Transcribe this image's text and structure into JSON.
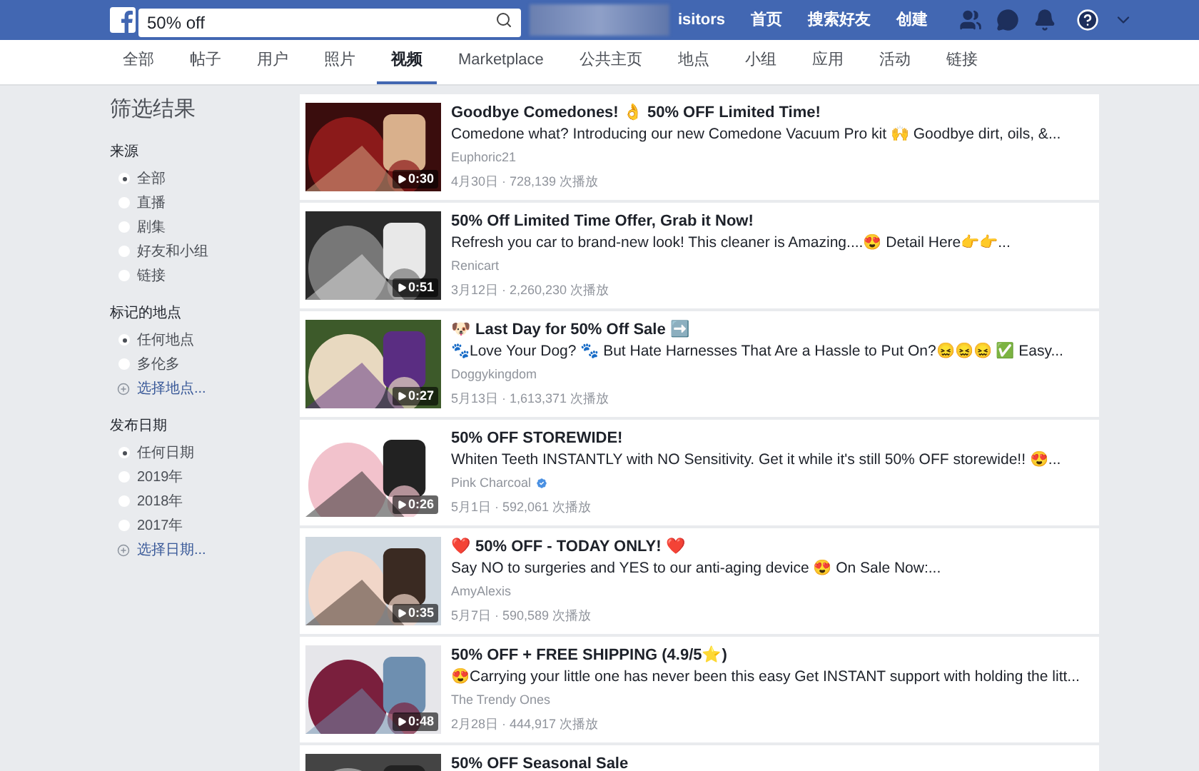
{
  "top_bar": {
    "search": {
      "value": "50% off"
    },
    "nav_partial": "isitors",
    "nav": [
      "首页",
      "搜索好友",
      "创建"
    ]
  },
  "tabs": [
    {
      "label": "全部",
      "selected": false
    },
    {
      "label": "帖子",
      "selected": false
    },
    {
      "label": "用户",
      "selected": false
    },
    {
      "label": "照片",
      "selected": false
    },
    {
      "label": "视频",
      "selected": true
    },
    {
      "label": "Marketplace",
      "selected": false
    },
    {
      "label": "公共主页",
      "selected": false
    },
    {
      "label": "地点",
      "selected": false
    },
    {
      "label": "小组",
      "selected": false
    },
    {
      "label": "应用",
      "selected": false
    },
    {
      "label": "活动",
      "selected": false
    },
    {
      "label": "链接",
      "selected": false
    }
  ],
  "sidebar": {
    "title": "筛选结果",
    "sections": [
      {
        "heading": "来源",
        "items": [
          {
            "kind": "radio",
            "label": "全部",
            "selected": true
          },
          {
            "kind": "radio",
            "label": "直播",
            "selected": false
          },
          {
            "kind": "radio",
            "label": "剧集",
            "selected": false
          },
          {
            "kind": "radio",
            "label": "好友和小组",
            "selected": false
          },
          {
            "kind": "radio",
            "label": "链接",
            "selected": false
          }
        ]
      },
      {
        "heading": "标记的地点",
        "items": [
          {
            "kind": "radio",
            "label": "任何地点",
            "selected": true
          },
          {
            "kind": "radio",
            "label": "多伦多",
            "selected": false
          },
          {
            "kind": "link",
            "label": "选择地点..."
          }
        ]
      },
      {
        "heading": "发布日期",
        "items": [
          {
            "kind": "radio",
            "label": "任何日期",
            "selected": true
          },
          {
            "kind": "radio",
            "label": "2019年",
            "selected": false
          },
          {
            "kind": "radio",
            "label": "2018年",
            "selected": false
          },
          {
            "kind": "radio",
            "label": "2017年",
            "selected": false
          },
          {
            "kind": "link",
            "label": "选择日期..."
          }
        ]
      }
    ]
  },
  "results": [
    {
      "duration": "0:30",
      "title": "Goodbye Comedones! 👌 50% OFF Limited Time!",
      "description": "Comedone what? Introducing our new Comedone Vacuum Pro kit 🙌 Goodbye dirt, oils, &...",
      "author": "Euphoric21",
      "verified": false,
      "meta": "4月30日 · 728,139 次播放"
    },
    {
      "duration": "0:51",
      "title": "50% Off Limited Time Offer, Grab it Now!",
      "description": "Refresh you car to brand-new look! This cleaner is Amazing....😍 Detail Here👉👉...",
      "author": "Renicart",
      "verified": false,
      "meta": "3月12日 · 2,260,230 次播放"
    },
    {
      "duration": "0:27",
      "title": "🐶 Last Day for 50% Off Sale ➡️",
      "description": "🐾Love Your Dog? 🐾 But Hate Harnesses That Are a Hassle to Put On?😖😖😖 ✅ Easy...",
      "author": "Doggykingdom",
      "verified": false,
      "meta": "5月13日 · 1,613,371 次播放"
    },
    {
      "duration": "0:26",
      "title": "50% OFF STOREWIDE!",
      "description": "Whiten Teeth INSTANTLY with NO Sensitivity. Get it while it's still 50% OFF storewide!! 😍...",
      "author": "Pink Charcoal",
      "verified": true,
      "meta": "5月1日 · 592,061 次播放"
    },
    {
      "duration": "0:35",
      "title": "❤️ 50% OFF - TODAY ONLY! ❤️",
      "description": "Say NO to surgeries and YES to our anti-aging device 😍 On Sale Now:...",
      "author": "AmyAlexis",
      "verified": false,
      "meta": "5月7日 · 590,589 次播放"
    },
    {
      "duration": "0:48",
      "title": "50% OFF + FREE SHIPPING (4.9/5⭐)",
      "description": "😍Carrying your little one has never been this easy Get INSTANT support with holding the litt...",
      "author": "The Trendy Ones",
      "verified": false,
      "meta": "2月28日 · 444,917 次播放"
    },
    {
      "title": "50% OFF Seasonal Sale"
    }
  ]
}
